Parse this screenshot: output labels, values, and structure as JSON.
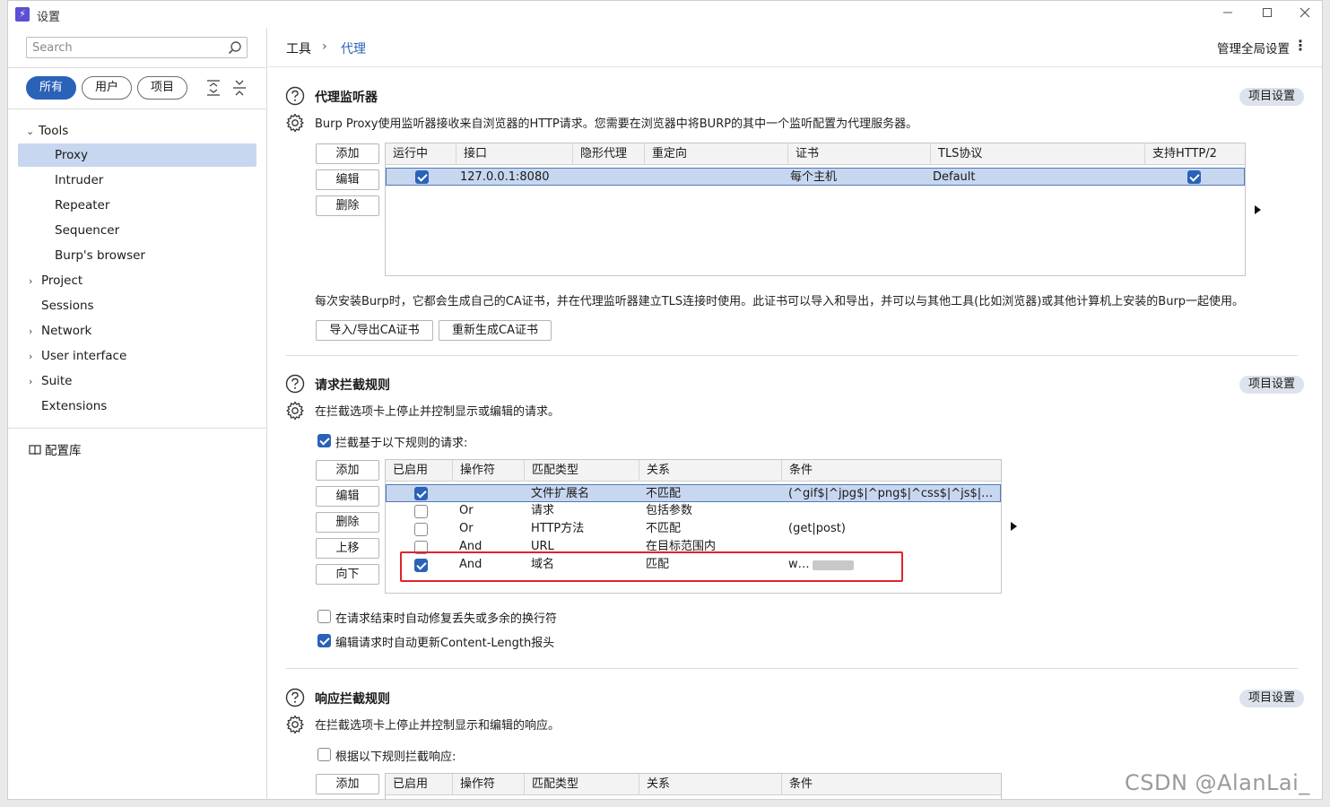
{
  "window": {
    "title": "设置",
    "app_icon_glyph": "⚡"
  },
  "sidebar": {
    "search_placeholder": "Search",
    "filters": [
      {
        "label": "所有"
      },
      {
        "label": "用户"
      },
      {
        "label": "项目"
      }
    ],
    "tree": [
      {
        "label": "Tools"
      },
      {
        "label": "Proxy"
      },
      {
        "label": "Intruder"
      },
      {
        "label": "Repeater"
      },
      {
        "label": "Sequencer"
      },
      {
        "label": "Burp's browser"
      },
      {
        "label": "Project"
      },
      {
        "label": "Sessions"
      },
      {
        "label": "Network"
      },
      {
        "label": "User interface"
      },
      {
        "label": "Suite"
      },
      {
        "label": "Extensions"
      }
    ],
    "library": "配置库"
  },
  "breadcrumb": {
    "root": "工具",
    "sep": "›",
    "current": "代理"
  },
  "header": {
    "global_settings": "管理全局设置",
    "menu": "⋮"
  },
  "listeners": {
    "title": "代理监听器",
    "desc": "Burp Proxy使用监听器接收来自浏览器的HTTP请求。您需要在浏览器中将BURP的其中一个监听配置为代理服务器。",
    "project_settings": "项目设置",
    "buttons": {
      "add": "添加",
      "edit": "编辑",
      "remove": "删除"
    },
    "columns": [
      "运行中",
      "接口",
      "隐形代理",
      "重定向",
      "证书",
      "TLS协议",
      "支持HTTP/2"
    ],
    "rows": [
      {
        "interface": "127.0.0.1:8080",
        "invisible": "",
        "redirect": "",
        "cert": "每个主机",
        "tls": "Default"
      }
    ],
    "ca_desc": "每次安装Burp时，它都会生成自己的CA证书，并在代理监听器建立TLS连接时使用。此证书可以导入和导出，并可以与其他工具(比如浏览器)或其他计算机上安装的Burp一起使用。",
    "ca_buttons": {
      "import_export": "导入/导出CA证书",
      "regenerate": "重新生成CA证书"
    }
  },
  "request_rules": {
    "title": "请求拦截规则",
    "desc": "在拦截选项卡上停止并控制显示或编辑的请求。",
    "project_settings": "项目设置",
    "intercept_label": "拦截基于以下规则的请求:",
    "buttons": {
      "add": "添加",
      "edit": "编辑",
      "remove": "删除",
      "up": "上移",
      "down": "向下"
    },
    "columns": [
      "已启用",
      "操作符",
      "匹配类型",
      "关系",
      "条件"
    ],
    "rows": [
      {
        "op": "",
        "type": "文件扩展名",
        "rel": "不匹配",
        "cond": "(^gif$|^jpg$|^png$|^css$|^js$|^ic..."
      },
      {
        "op": "Or",
        "type": "请求",
        "rel": "包括参数",
        "cond": ""
      },
      {
        "op": "Or",
        "type": "HTTP方法",
        "rel": "不匹配",
        "cond": "(get|post)"
      },
      {
        "op": "And",
        "type": "URL",
        "rel": "在目标范围内",
        "cond": ""
      },
      {
        "op": "And",
        "type": "域名",
        "rel": "匹配",
        "cond": "www."
      }
    ],
    "opt_fix_newlines": "在请求结束时自动修复丢失或多余的换行符",
    "opt_update_length": "编辑请求时自动更新Content-Length报头"
  },
  "response_rules": {
    "title": "响应拦截规则",
    "desc": "在拦截选项卡上停止并控制显示和编辑的响应。",
    "project_settings": "项目设置",
    "intercept_label": "根据以下规则拦截响应:",
    "buttons": {
      "add": "添加"
    },
    "columns": [
      "已启用",
      "操作符",
      "匹配类型",
      "关系",
      "条件"
    ]
  },
  "watermark": "CSDN @AlanLai_"
}
